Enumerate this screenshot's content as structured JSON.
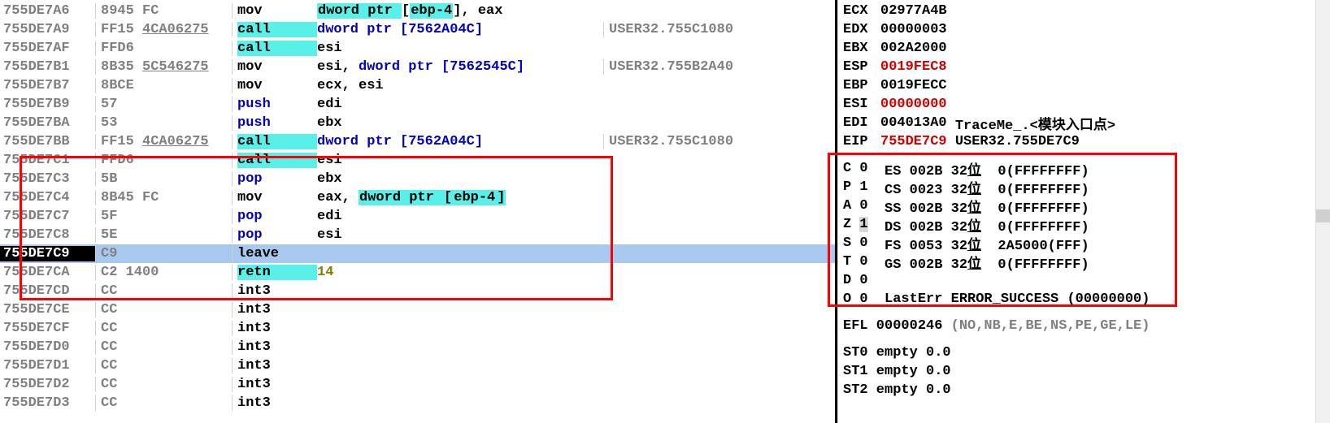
{
  "disasm": {
    "rows": [
      {
        "addr": "755DE7A6",
        "bytes": "8945 FC",
        "mnem": "mov",
        "mnem_style": "black",
        "ops": [
          {
            "t": "dword ptr ",
            "s": "hl-cyan"
          },
          {
            "t": "[",
            "s": "black"
          },
          {
            "t": "ebp-4",
            "s": "hl-cyan"
          },
          {
            "t": "]",
            "s": "black"
          },
          {
            "t": ", ",
            "s": "black"
          },
          {
            "t": "eax",
            "s": "black"
          }
        ],
        "comment": ""
      },
      {
        "addr": "755DE7A9",
        "bytes": "FF15 ",
        "bytes_u": "4CA06275",
        "mnem": "call",
        "mnem_style": "hl-cyan-bold",
        "ops": [
          {
            "t": "dword ptr ",
            "s": "blue"
          },
          {
            "t": "[",
            "s": "blue"
          },
          {
            "t": "7562A04C",
            "s": "blue"
          },
          {
            "t": "]",
            "s": "blue"
          }
        ],
        "comment": "USER32.755C1080"
      },
      {
        "addr": "755DE7AF",
        "bytes": "FFD6",
        "mnem": "call",
        "mnem_style": "hl-cyan-bold",
        "ops": [
          {
            "t": "esi",
            "s": "black"
          }
        ],
        "comment": ""
      },
      {
        "addr": "755DE7B1",
        "bytes": "8B35 ",
        "bytes_u": "5C546275",
        "mnem": "mov",
        "mnem_style": "black",
        "ops": [
          {
            "t": "esi",
            "s": "black"
          },
          {
            "t": ", ",
            "s": "black"
          },
          {
            "t": "dword ptr ",
            "s": "blue"
          },
          {
            "t": "[",
            "s": "blue"
          },
          {
            "t": "7562545C",
            "s": "blue"
          },
          {
            "t": "]",
            "s": "blue"
          }
        ],
        "comment": "USER32.755B2A40"
      },
      {
        "addr": "755DE7B7",
        "bytes": "8BCE",
        "mnem": "mov",
        "mnem_style": "black",
        "ops": [
          {
            "t": "ecx",
            "s": "black"
          },
          {
            "t": ", ",
            "s": "black"
          },
          {
            "t": "esi",
            "s": "black"
          }
        ],
        "comment": ""
      },
      {
        "addr": "755DE7B9",
        "bytes": "57",
        "mnem": "push",
        "mnem_style": "blue",
        "ops": [
          {
            "t": "edi",
            "s": "black"
          }
        ],
        "comment": ""
      },
      {
        "addr": "755DE7BA",
        "bytes": "53",
        "mnem": "push",
        "mnem_style": "blue",
        "ops": [
          {
            "t": "ebx",
            "s": "black"
          }
        ],
        "comment": ""
      },
      {
        "addr": "755DE7BB",
        "bytes": "FF15 ",
        "bytes_u": "4CA06275",
        "mnem": "call",
        "mnem_style": "hl-cyan-bold",
        "ops": [
          {
            "t": "dword ptr ",
            "s": "blue"
          },
          {
            "t": "[",
            "s": "blue"
          },
          {
            "t": "7562A04C",
            "s": "blue"
          },
          {
            "t": "]",
            "s": "blue"
          }
        ],
        "comment": "USER32.755C1080"
      },
      {
        "addr": "755DE7C1",
        "bytes": "FFD6",
        "mnem": "call",
        "mnem_style": "hl-cyan-bold",
        "ops": [
          {
            "t": "esi",
            "s": "black"
          }
        ],
        "comment": ""
      },
      {
        "addr": "755DE7C3",
        "bytes": "5B",
        "mnem": "pop",
        "mnem_style": "blue",
        "ops": [
          {
            "t": "ebx",
            "s": "black"
          }
        ],
        "comment": ""
      },
      {
        "addr": "755DE7C4",
        "bytes": "8B45 FC",
        "mnem": "mov",
        "mnem_style": "black",
        "ops": [
          {
            "t": "eax",
            "s": "black"
          },
          {
            "t": ", ",
            "s": "black"
          },
          {
            "t": "dword ptr ",
            "s": "hl-cyan"
          },
          {
            "t": "[",
            "s": "hl-cyan"
          },
          {
            "t": "ebp-4",
            "s": "hl-cyan"
          },
          {
            "t": "]",
            "s": "hl-cyan"
          }
        ],
        "comment": ""
      },
      {
        "addr": "755DE7C7",
        "bytes": "5F",
        "mnem": "pop",
        "mnem_style": "blue",
        "ops": [
          {
            "t": "edi",
            "s": "black"
          }
        ],
        "comment": ""
      },
      {
        "addr": "755DE7C8",
        "bytes": "5E",
        "mnem": "pop",
        "mnem_style": "blue",
        "ops": [
          {
            "t": "esi",
            "s": "black"
          }
        ],
        "comment": ""
      },
      {
        "addr": "755DE7C9",
        "bytes": "C9",
        "mnem": "leave",
        "mnem_style": "black",
        "ops": [],
        "comment": "",
        "eip": true
      },
      {
        "addr": "755DE7CA",
        "bytes": "C2 1400",
        "mnem": "retn",
        "mnem_style": "hl-cyan-bold",
        "ops": [
          {
            "t": "14",
            "s": "olive"
          }
        ],
        "comment": ""
      },
      {
        "addr": "755DE7CD",
        "bytes": "CC",
        "mnem": "int3",
        "mnem_style": "black",
        "ops": [],
        "comment": ""
      },
      {
        "addr": "755DE7CE",
        "bytes": "CC",
        "mnem": "int3",
        "mnem_style": "black",
        "ops": [],
        "comment": ""
      },
      {
        "addr": "755DE7CF",
        "bytes": "CC",
        "mnem": "int3",
        "mnem_style": "black",
        "ops": [],
        "comment": ""
      },
      {
        "addr": "755DE7D0",
        "bytes": "CC",
        "mnem": "int3",
        "mnem_style": "black",
        "ops": [],
        "comment": ""
      },
      {
        "addr": "755DE7D1",
        "bytes": "CC",
        "mnem": "int3",
        "mnem_style": "black",
        "ops": [],
        "comment": ""
      },
      {
        "addr": "755DE7D2",
        "bytes": "CC",
        "mnem": "int3",
        "mnem_style": "black",
        "ops": [],
        "comment": ""
      },
      {
        "addr": "755DE7D3",
        "bytes": "CC",
        "mnem": "int3",
        "mnem_style": "black",
        "ops": [],
        "comment": ""
      }
    ]
  },
  "registers": {
    "gp": [
      {
        "name": "ECX",
        "val": "02977A4B",
        "style": "black"
      },
      {
        "name": "EDX",
        "val": "00000003",
        "style": "black"
      },
      {
        "name": "EBX",
        "val": "002A2000",
        "style": "black"
      },
      {
        "name": "ESP",
        "val": "0019FEC8",
        "style": "red"
      },
      {
        "name": "EBP",
        "val": "0019FECC",
        "style": "black"
      },
      {
        "name": "ESI",
        "val": "00000000",
        "style": "red"
      },
      {
        "name": "EDI",
        "val": "004013A0",
        "style": "black",
        "extra": " TraceMe_.<模块入口点>"
      },
      {
        "name": "EIP",
        "val": "755DE7C9",
        "style": "red",
        "extra_black": " USER32.755DE7C9"
      }
    ],
    "flags": [
      {
        "f": "C",
        "v": "0",
        "seg": "ES",
        "segv": "002B",
        "bits": "32位",
        "base": "0(FFFFFFFF)"
      },
      {
        "f": "P",
        "v": "1",
        "seg": "CS",
        "segv": "0023",
        "bits": "32位",
        "base": "0(FFFFFFFF)"
      },
      {
        "f": "A",
        "v": "0",
        "seg": "SS",
        "segv": "002B",
        "bits": "32位",
        "base": "0(FFFFFFFF)"
      },
      {
        "f": "Z",
        "v": "1",
        "vsel": true,
        "seg": "DS",
        "segv": "002B",
        "bits": "32位",
        "base": "0(FFFFFFFF)"
      },
      {
        "f": "S",
        "v": "0",
        "seg": "FS",
        "segv": "0053",
        "bits": "32位",
        "base": "2A5000(FFF)"
      },
      {
        "f": "T",
        "v": "0",
        "seg": "GS",
        "segv": "002B",
        "bits": "32位",
        "base": "0(FFFFFFFF)"
      },
      {
        "f": "D",
        "v": "0"
      }
    ],
    "lasterr": {
      "f": "O",
      "v": "0",
      "label": "LastErr",
      "val": "ERROR_SUCCESS (00000000)"
    },
    "efl": {
      "name": "EFL",
      "val": "00000246",
      "flags": "(NO,NB,E,BE,NS,PE,GE,LE)"
    },
    "fpu": [
      {
        "name": "ST0",
        "val": "empty 0.0"
      },
      {
        "name": "ST1",
        "val": "empty 0.0"
      },
      {
        "name": "ST2",
        "val": "empty 0.0"
      }
    ]
  },
  "colors": {
    "highlight_cyan": "#58f0e8",
    "eip_row": "#a8c8f0",
    "red": "#d00000",
    "blue": "#0000c0",
    "olive": "#808000"
  }
}
